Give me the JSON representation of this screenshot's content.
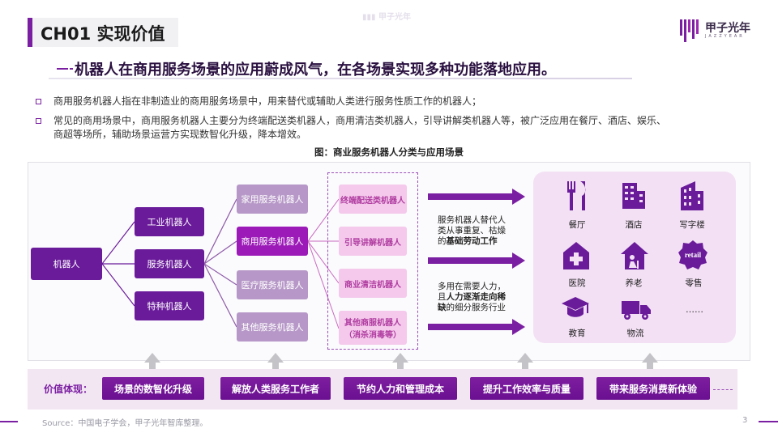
{
  "header": {
    "title": "CH01 实现价值",
    "watermark": "甲子光年",
    "logo_text": "甲子光年",
    "logo_sub": "JAZZYEAR"
  },
  "headline": "机器人在商用服务场景的应用蔚成风气，在各场景实现多种功能落地应用。",
  "bullets": [
    {
      "line1": "商用服务机器人指在非制造业的商用服务场景中，用来替代或辅助人类进行服务性质工作的机器人；",
      "line2": ""
    },
    {
      "line1": "常见的商用场景中，商用服务机器人主要分为终端配送类机器人，商用清洁类机器人，引导讲解类机器人等，被广泛应用在餐厅、酒店、娱乐、",
      "line2": "商超等场所，辅助场景运营方实现数智化升级，降本增效。"
    }
  ],
  "figure_title": "图：商业服务机器人分类与应用场景",
  "diagram": {
    "root": "机器人",
    "level1": [
      "工业机器人",
      "服务机器人",
      "特种机器人"
    ],
    "level2": [
      "家用服务机器人",
      "商用服务机器人",
      "医疗服务机器人",
      "其他服务机器人"
    ],
    "level3": [
      {
        "line1": "终端配送类机器人",
        "line2": ""
      },
      {
        "line1": "引导讲解机器人",
        "line2": ""
      },
      {
        "line1": "商业清洁机器人",
        "line2": ""
      },
      {
        "line1": "其他商服机器人",
        "line2": "（消杀消毒等）"
      }
    ],
    "desc1": {
      "a": "服务机器人替代人",
      "b": "类从事重复、枯燥",
      "c_pre": "的",
      "c_bold": "基础劳动工作"
    },
    "desc2": {
      "a": "多用在需要人力，",
      "b_pre": "且",
      "b_bold": "人力逐渐走向稀",
      "c_bold": "缺",
      "c_post": "的细分服务行业"
    },
    "scenes": [
      "餐厅",
      "酒店",
      "写字楼",
      "医院",
      "养老",
      "零售",
      "教育",
      "物流"
    ],
    "retail_badge": "retail",
    "more": "……",
    "accent": "#6a1b9a"
  },
  "values": {
    "label": "价值体现：",
    "items": [
      "场景的数智化升级",
      "解放人类服务工作者",
      "节约人力和管理成本",
      "提升工作效率与质量",
      "带来服务消费新体验"
    ]
  },
  "footer": {
    "source": "Source：中国电子学会，甲子光年智库整理。",
    "page": "3"
  }
}
